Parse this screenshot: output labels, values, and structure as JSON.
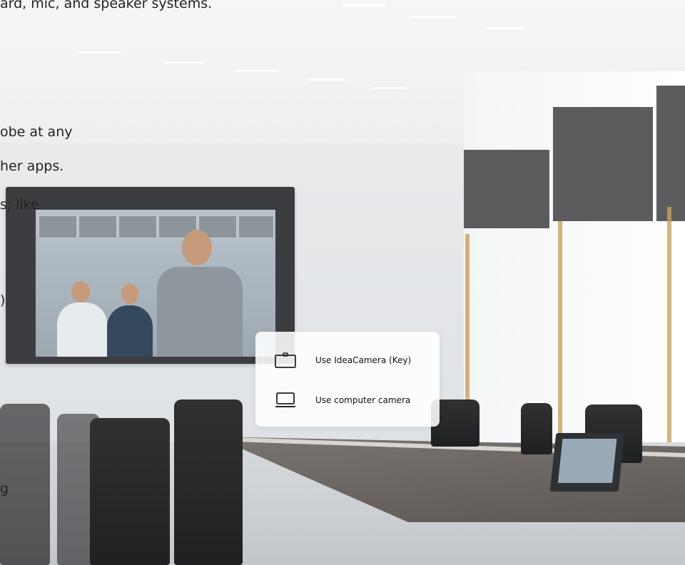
{
  "text_fragments": {
    "line1": "ard, mic, and speaker systems.",
    "line2": "obe at any",
    "line3": "her apps.",
    "line4": "s, like",
    "line5": ").",
    "line6": "g"
  },
  "camera_menu": {
    "items": [
      {
        "label": "Use IdeaCamera (Key)",
        "icon": "camera-icon"
      },
      {
        "label": "Use computer camera",
        "icon": "laptop-icon"
      }
    ]
  },
  "colors": {
    "menu_bg": "#ffffff",
    "text": "#111111",
    "icon": "#222222"
  }
}
